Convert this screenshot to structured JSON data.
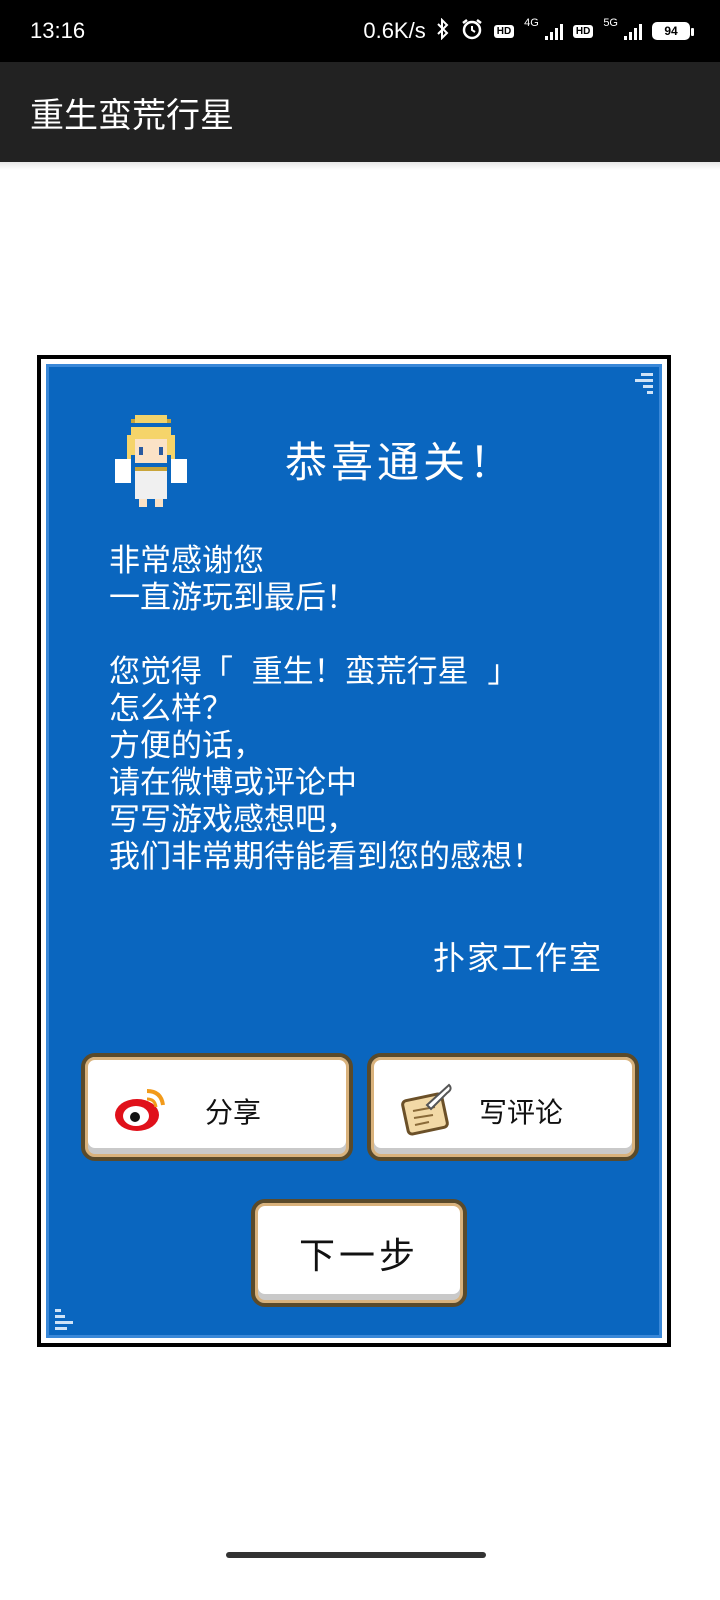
{
  "status_bar": {
    "time": "13:16",
    "net_speed": "0.6K/s",
    "net1": "4G",
    "net2": "5G",
    "hd": "HD",
    "battery": "94"
  },
  "app_bar": {
    "title": "重生蛮荒行星"
  },
  "dialog": {
    "title": "恭喜通关！",
    "lines_1": [
      "非常感谢您",
      "一直游玩到最后！"
    ],
    "lines_2": [
      "您觉得「 重生！蛮荒行星 」",
      "怎么样？",
      "方便的话，",
      "请在微博或评论中",
      "写写游戏感想吧，",
      "我们非常期待能看到您的感想！"
    ],
    "signature": "扑家工作室",
    "share_label": "分享",
    "review_label": "写评论",
    "next_label": "下一步"
  },
  "colors": {
    "dialog_bg": "#0a66bf",
    "app_bar": "#222222",
    "button_border": "#d9b27c"
  },
  "icons": [
    "bluetooth-icon",
    "alarm-icon",
    "angel-icon",
    "weibo-icon",
    "scroll-quill-icon"
  ]
}
